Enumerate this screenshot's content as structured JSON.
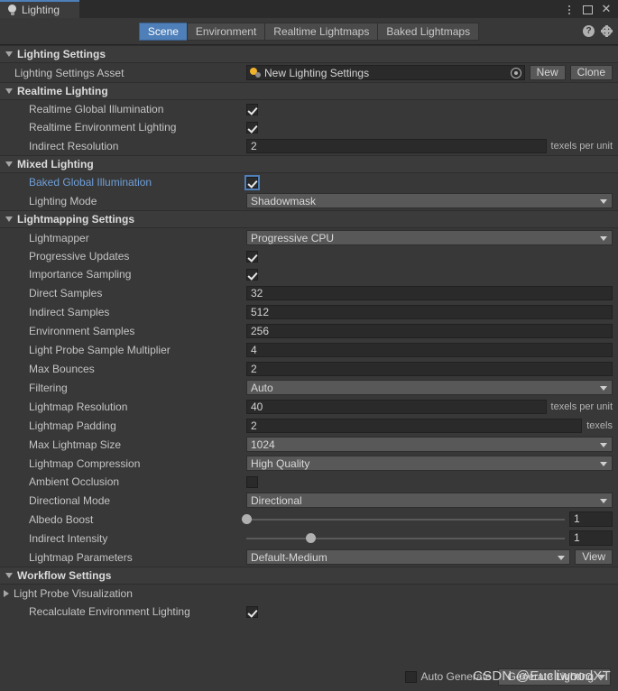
{
  "window": {
    "tab_title": "Lighting",
    "tab_icon": "lightbulb-icon",
    "controls": {
      "menu": "kebab-menu-icon",
      "maximize": "maximize-icon",
      "close": "close-icon"
    }
  },
  "toolbar": {
    "tabs": [
      {
        "label": "Scene",
        "active": true
      },
      {
        "label": "Environment",
        "active": false
      },
      {
        "label": "Realtime Lightmaps",
        "active": false
      },
      {
        "label": "Baked Lightmaps",
        "active": false
      }
    ],
    "help_icon": "help-icon",
    "settings_icon": "gear-icon"
  },
  "sections": {
    "lighting_settings": {
      "title": "Lighting Settings",
      "expanded": true,
      "asset_row": {
        "label": "Lighting Settings Asset",
        "value": "New Lighting Settings",
        "icon": "lighting-settings-asset-icon",
        "picker": "object-picker-icon",
        "new_label": "New",
        "clone_label": "Clone"
      }
    },
    "realtime_lighting": {
      "title": "Realtime Lighting",
      "expanded": true,
      "rows": [
        {
          "label": "Realtime Global Illumination",
          "type": "checkbox",
          "checked": true,
          "indent": 1
        },
        {
          "label": "Realtime Environment Lighting",
          "type": "checkbox",
          "checked": true,
          "indent": 2
        },
        {
          "label": "Indirect Resolution",
          "type": "text",
          "value": "2",
          "suffix": "texels per unit",
          "indent": 2
        }
      ]
    },
    "mixed_lighting": {
      "title": "Mixed Lighting",
      "expanded": true,
      "rows": [
        {
          "label": "Baked Global Illumination",
          "type": "checkbox",
          "checked": true,
          "focused": true,
          "link": true,
          "indent": 1
        },
        {
          "label": "Lighting Mode",
          "type": "dropdown",
          "value": "Shadowmask",
          "indent": 1
        }
      ]
    },
    "lightmapping_settings": {
      "title": "Lightmapping Settings",
      "expanded": true,
      "rows": [
        {
          "label": "Lightmapper",
          "type": "dropdown",
          "value": "Progressive CPU",
          "indent": 1
        },
        {
          "label": "Progressive Updates",
          "type": "checkbox",
          "checked": true,
          "indent": 2
        },
        {
          "label": "Importance Sampling",
          "type": "checkbox",
          "checked": true,
          "indent": 2
        },
        {
          "label": "Direct Samples",
          "type": "text",
          "value": "32",
          "indent": 2
        },
        {
          "label": "Indirect Samples",
          "type": "text",
          "value": "512",
          "indent": 2
        },
        {
          "label": "Environment Samples",
          "type": "text",
          "value": "256",
          "indent": 2
        },
        {
          "label": "Light Probe Sample Multiplier",
          "type": "text",
          "value": "4",
          "indent": 2
        },
        {
          "label": "Max Bounces",
          "type": "text",
          "value": "2",
          "indent": 2
        },
        {
          "label": "Filtering",
          "type": "dropdown",
          "value": "Auto",
          "indent": 2
        },
        {
          "label": "Lightmap Resolution",
          "type": "text",
          "value": "40",
          "suffix": "texels per unit",
          "indent": 1
        },
        {
          "label": "Lightmap Padding",
          "type": "text",
          "value": "2",
          "suffix": "texels",
          "indent": 1
        },
        {
          "label": "Max Lightmap Size",
          "type": "dropdown",
          "value": "1024",
          "indent": 1
        },
        {
          "label": "Lightmap Compression",
          "type": "dropdown",
          "value": "High Quality",
          "indent": 1
        },
        {
          "label": "Ambient Occlusion",
          "type": "checkbox",
          "checked": false,
          "indent": 1
        },
        {
          "label": "Directional Mode",
          "type": "dropdown",
          "value": "Directional",
          "indent": 1
        },
        {
          "label": "Albedo Boost",
          "type": "slider",
          "value": "1",
          "percent": 0,
          "indent": 1
        },
        {
          "label": "Indirect Intensity",
          "type": "slider",
          "value": "1",
          "percent": 20,
          "indent": 1
        },
        {
          "label": "Lightmap Parameters",
          "type": "dropdown_button",
          "value": "Default-Medium",
          "button_label": "View",
          "indent": 1
        }
      ]
    },
    "workflow_settings": {
      "title": "Workflow Settings",
      "expanded": true,
      "light_probe_visualization": {
        "title": "Light Probe Visualization",
        "expanded": false
      },
      "rows": [
        {
          "label": "Recalculate Environment Lighting",
          "type": "checkbox",
          "checked": true,
          "indent": 1
        }
      ]
    }
  },
  "footer": {
    "auto_generate_label": "Auto Generate",
    "auto_generate_checked": false,
    "generate_button_label": "Generate Lighting",
    "watermark": "CSDN @EucliwoodXT"
  },
  "colors": {
    "accent": "#4e7fb8",
    "background": "#383838",
    "header": "#3b3b3b",
    "field": "#2a2a2a",
    "dropdown": "#585858",
    "link": "#6f9fd8"
  }
}
